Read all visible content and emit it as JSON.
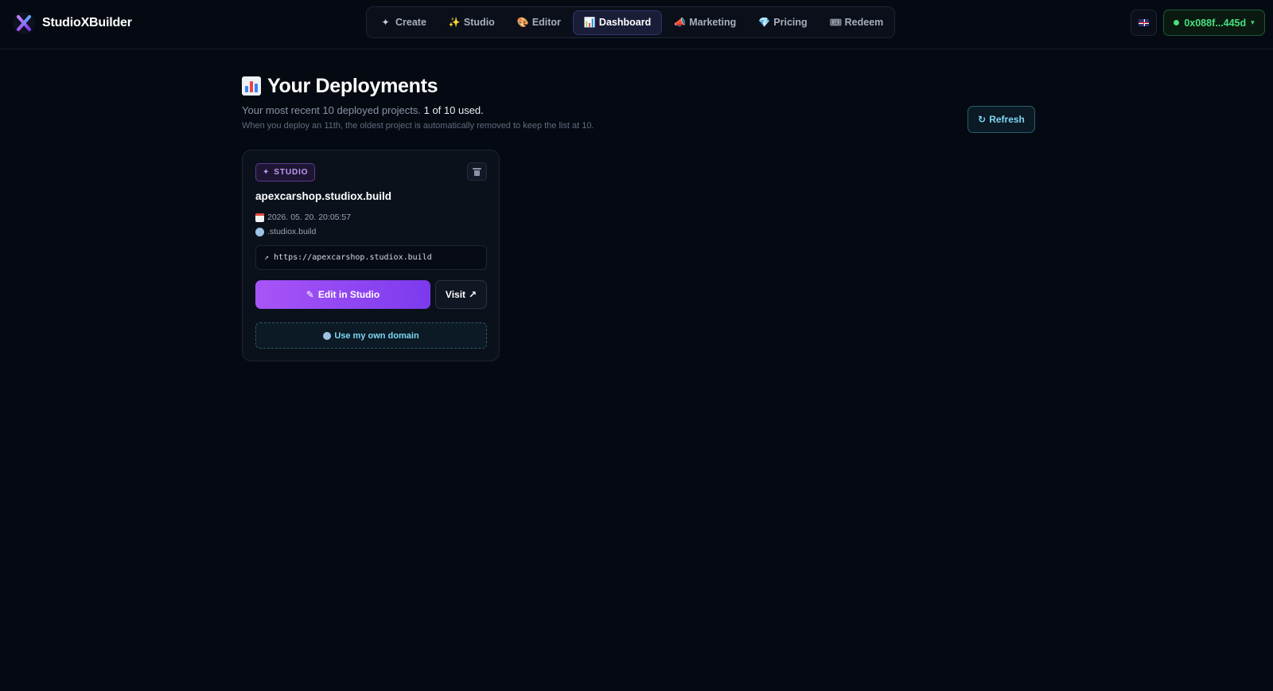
{
  "app": {
    "name": "StudioXBuilder"
  },
  "nav": {
    "tabs": [
      {
        "label": "Create",
        "icon": "sparkle-icon",
        "glyph": "✦"
      },
      {
        "label": "Studio",
        "icon": "magic-sparkles-icon",
        "glyph": "✨"
      },
      {
        "label": "Editor",
        "icon": "palette-icon",
        "glyph": "🎨"
      },
      {
        "label": "Dashboard",
        "icon": "bar-chart-icon",
        "glyph": "📊",
        "active": true
      },
      {
        "label": "Marketing",
        "icon": "megaphone-icon",
        "glyph": "📣"
      },
      {
        "label": "Pricing",
        "icon": "gem-icon",
        "glyph": "💎"
      },
      {
        "label": "Redeem",
        "icon": "ticket-icon",
        "glyph": "🎟"
      }
    ]
  },
  "header_right": {
    "language_icon": "uk-flag-icon",
    "wallet_label": "0x088f...445d",
    "wallet_status_color": "#4ade80"
  },
  "page": {
    "title": "Your Deployments",
    "subtitle_prefix": "Your most recent 10 deployed projects. ",
    "subtitle_used": "1 of 10 used.",
    "note": "When you deploy an 11th, the oldest project is automatically removed to keep the list at 10.",
    "refresh_label": "Refresh",
    "refresh_glyph": "↻"
  },
  "deployments": [
    {
      "badge": "STUDIO",
      "badge_glyph": "✦",
      "domain": "apexcarshop.studiox.build",
      "date": "2026. 05. 20. 20:05:57",
      "suffix": ".studiox.build",
      "url": "https://apexcarshop.studiox.build",
      "url_glyph": "↗",
      "edit_label": "Edit in Studio",
      "edit_glyph": "✎",
      "visit_label": "Visit",
      "visit_glyph": "↗",
      "own_domain_label": "Use my own domain"
    }
  ],
  "colors": {
    "background": "#050a12",
    "accent_purple": "#a855f7",
    "accent_cyan": "#7fd6f5",
    "wallet_green": "#4ade80"
  }
}
